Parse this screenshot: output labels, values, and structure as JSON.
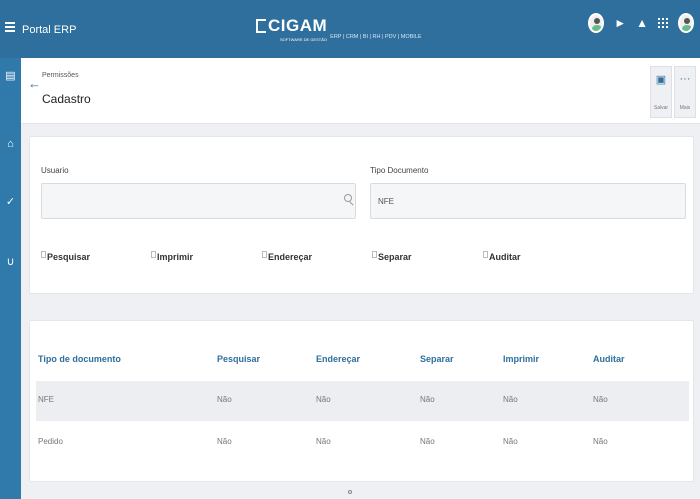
{
  "topbar": {
    "portal_title": "Portal ERP",
    "logo_text": "CIGAM",
    "logo_subtitle": "SOFTWARE DE GESTÃO",
    "logo_modules": "ERP | CRM | BI | RH | PDV | MOBILE",
    "color": "#2e6f9e"
  },
  "sidebar": {
    "color": "#2f7aab",
    "items": [
      {
        "icon": "catalog-icon"
      },
      {
        "icon": "warehouse-icon"
      },
      {
        "icon": "cart-check-icon"
      },
      {
        "icon": "cart-icon"
      }
    ]
  },
  "header": {
    "breadcrumb": "Permissões",
    "title": "Cadastro",
    "save_label": "Salvar",
    "more_label": "Mais",
    "more_glyph": "···"
  },
  "filters": {
    "usuario_label": "Usuario",
    "usuario_value": "",
    "tipo_label": "Tipo Documento",
    "tipo_value": "NFE",
    "checks": {
      "pesquisar": "Pesquisar",
      "imprimir": "Imprimir",
      "enderecar": "Endereçar",
      "separar": "Separar",
      "auditar": "Auditar"
    }
  },
  "table": {
    "headers": {
      "tipo": "Tipo de documento",
      "pesquisar": "Pesquisar",
      "enderecar": "Endereçar",
      "separar": "Separar",
      "imprimir": "Imprimir",
      "auditar": "Auditar"
    },
    "rows": [
      {
        "tipo": "NFE",
        "pesquisar": "Não",
        "enderecar": "Não",
        "separar": "Não",
        "imprimir": "Não",
        "auditar": "Não"
      },
      {
        "tipo": "Pedido",
        "pesquisar": "Não",
        "enderecar": "Não",
        "separar": "Não",
        "imprimir": "Não",
        "auditar": "Não"
      }
    ]
  }
}
